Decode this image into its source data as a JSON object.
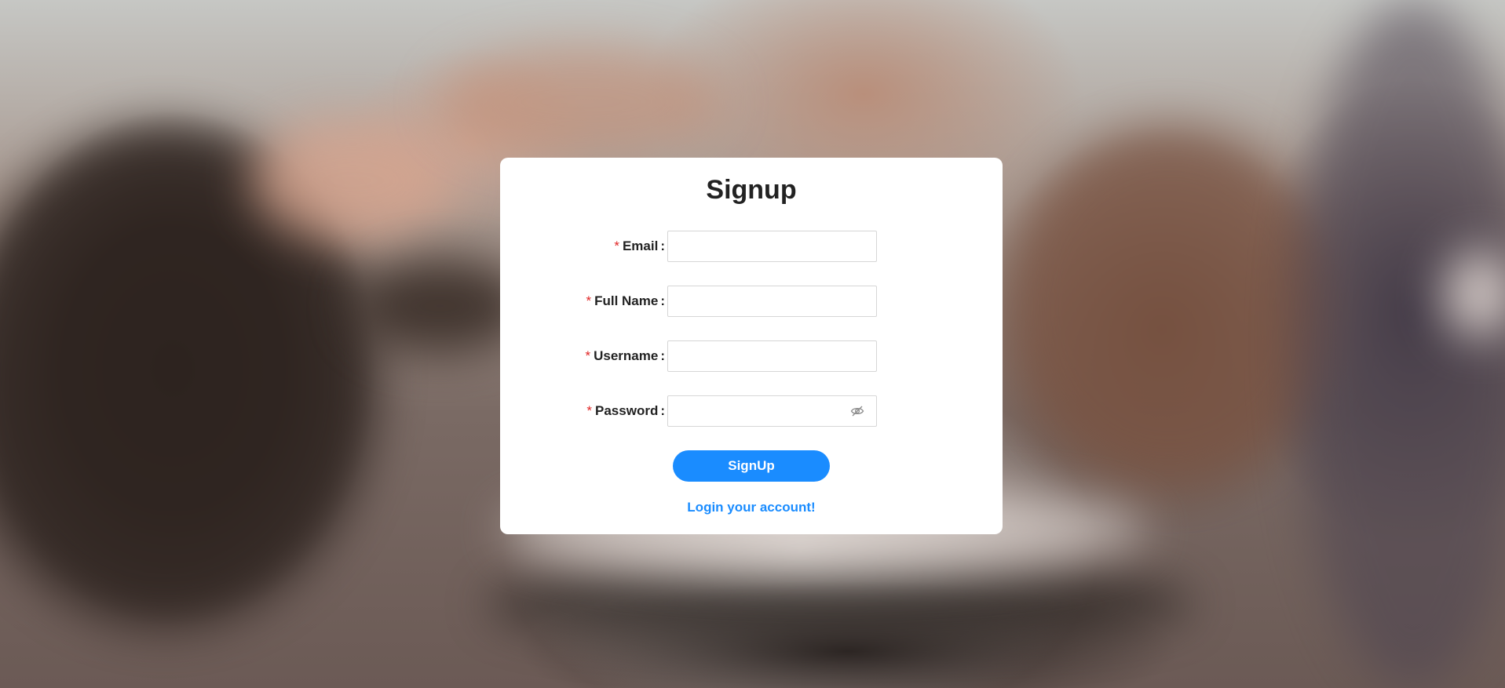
{
  "page": {
    "accent_color": "#1a8cff",
    "required_color": "#e02424"
  },
  "form": {
    "title": "Signup",
    "fields": [
      {
        "label": "Email",
        "required_mark": "*",
        "value": "",
        "placeholder": ""
      },
      {
        "label": "Full Name",
        "required_mark": "*",
        "value": "",
        "placeholder": ""
      },
      {
        "label": "Username",
        "required_mark": "*",
        "value": "",
        "placeholder": ""
      },
      {
        "label": "Password",
        "required_mark": "*",
        "value": "",
        "placeholder": "",
        "icon": "eye-invisible-icon"
      }
    ],
    "label_separator": ":",
    "submit_label": "SignUp",
    "login_link": "Login your account!"
  }
}
